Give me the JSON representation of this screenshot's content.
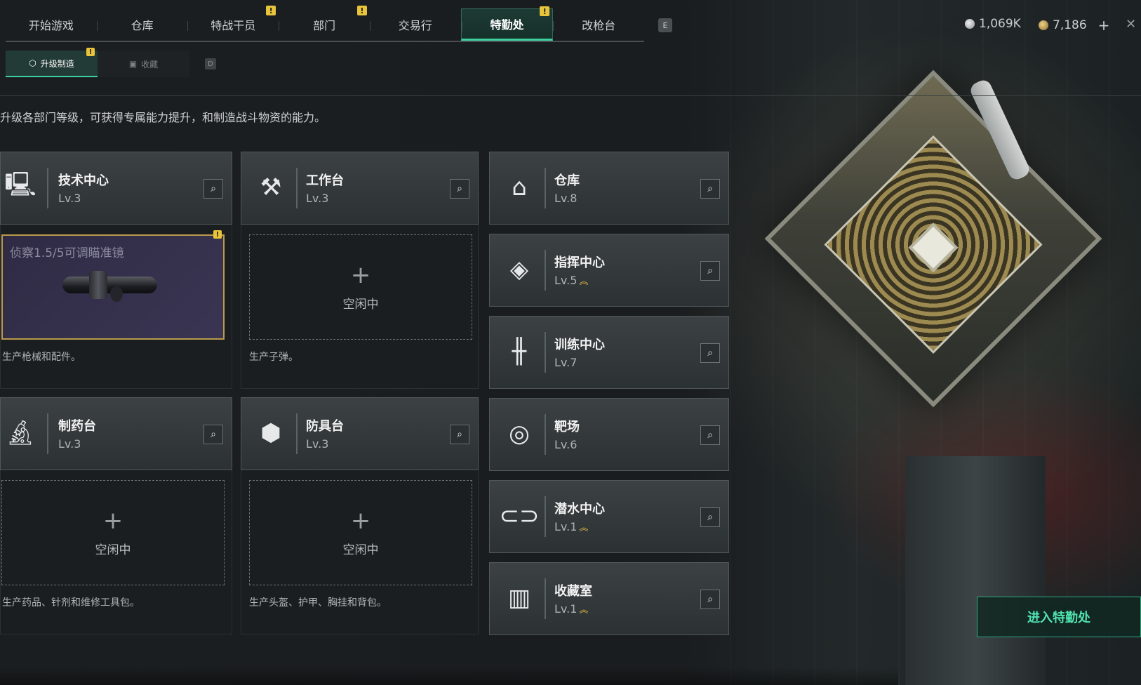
{
  "topnav": {
    "tabs": [
      {
        "label": "开始游戏",
        "alert": false,
        "active": false
      },
      {
        "label": "仓库",
        "alert": false,
        "active": false
      },
      {
        "label": "特战干员",
        "alert": true,
        "active": false
      },
      {
        "label": "部门",
        "alert": true,
        "active": false
      },
      {
        "label": "交易行",
        "alert": false,
        "active": false
      },
      {
        "label": "特勤处",
        "alert": true,
        "active": true
      },
      {
        "label": "改枪台",
        "alert": false,
        "active": false
      }
    ],
    "hotkey_e": "E"
  },
  "currency": {
    "silver": "1,069K",
    "gold": "7,186",
    "add": "+"
  },
  "subtabs": {
    "upgrade": "升级制造",
    "collection": "收藏",
    "hotkey_d": "D"
  },
  "description": "升级各部门等级，可获得专属能力提升，和制造战斗物资的能力。",
  "alert_mark": "!",
  "departments": {
    "tech": {
      "name": "技术中心",
      "level": "Lv.3",
      "icon": "monitor-icon"
    },
    "workbench": {
      "name": "工作台",
      "level": "Lv.3",
      "icon": "hammer-wrench-icon"
    },
    "warehouse": {
      "name": "仓库",
      "level": "Lv.8",
      "icon": "garage-icon"
    },
    "command": {
      "name": "指挥中心",
      "level": "Lv.5",
      "icon": "diamond-target-icon",
      "upgradable": true
    },
    "training": {
      "name": "训练中心",
      "level": "Lv.7",
      "icon": "dumbbell-icon"
    },
    "pharmacy": {
      "name": "制药台",
      "level": "Lv.3",
      "icon": "microscope-icon"
    },
    "armor": {
      "name": "防具台",
      "level": "Lv.3",
      "icon": "cubes-icon"
    },
    "range": {
      "name": "靶场",
      "level": "Lv.6",
      "icon": "crosshair-icon"
    },
    "diving": {
      "name": "潜水中心",
      "level": "Lv.1",
      "icon": "diving-mask-icon",
      "upgradable": true
    },
    "collection": {
      "name": "收藏室",
      "level": "Lv.1",
      "icon": "display-case-icon",
      "upgradable": true
    }
  },
  "upgrade_arrow": "︽",
  "production": {
    "tech_item": "侦察1.5/5可调瞄准镜",
    "tech_desc": "生产枪械和配件。",
    "workbench_desc": "生产子弹。",
    "pharmacy_desc": "生产药品、针剂和维修工具包。",
    "armor_desc": "生产头盔、护甲、胸挂和背包。",
    "idle": "空闲中",
    "plus": "+"
  },
  "enter_button": "进入特勤处",
  "colors": {
    "accent": "#3fd0a0",
    "alert": "#e8c43a",
    "upgrade": "#e2b94a",
    "item_border": "#b99a4b"
  }
}
